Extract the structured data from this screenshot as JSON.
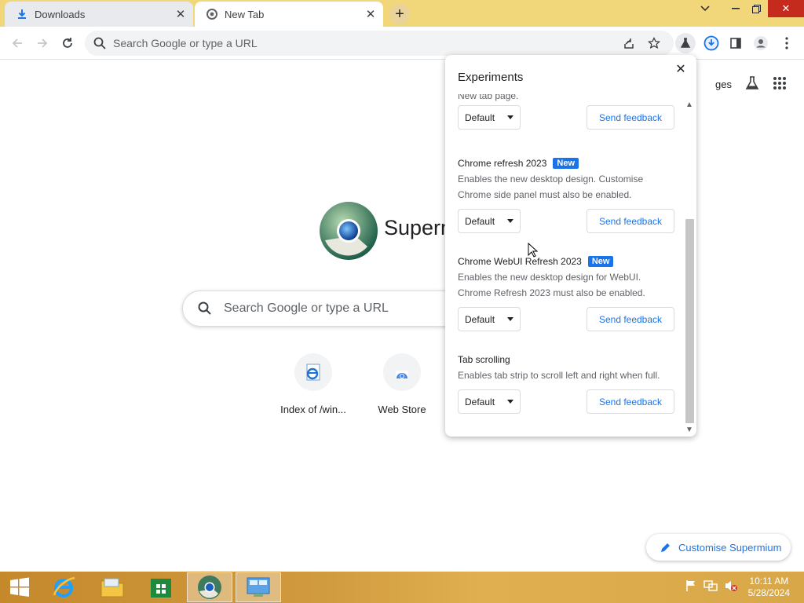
{
  "tabs": [
    {
      "title": "Downloads",
      "icon": "download-icon"
    },
    {
      "title": "New Tab",
      "icon": "chrome-icon"
    }
  ],
  "toolbar": {
    "omnibox_placeholder": "Search Google or type a URL"
  },
  "ntp": {
    "logo_text": "Superm",
    "header_link": "ges",
    "search_placeholder": "Search Google or type a URL",
    "shortcuts": [
      {
        "label": "Index of /win...",
        "icon": "ie-page-icon"
      },
      {
        "label": "Web Store",
        "icon": "web-store-icon"
      }
    ],
    "customise_label": "Customise Supermium"
  },
  "experiments": {
    "title": "Experiments",
    "items": [
      {
        "name": "",
        "badge": "",
        "desc": [
          "New tab page."
        ],
        "select": "Default",
        "feedback": "Send feedback"
      },
      {
        "name": "Chrome refresh 2023",
        "badge": "New",
        "desc": [
          "Enables the new desktop design. Customise",
          "Chrome side panel must also be enabled."
        ],
        "select": "Default",
        "feedback": "Send feedback"
      },
      {
        "name": "Chrome WebUI Refresh 2023",
        "badge": "New",
        "desc": [
          "Enables the new desktop design for WebUI.",
          "Chrome Refresh 2023 must also be enabled."
        ],
        "select": "Default",
        "feedback": "Send feedback"
      },
      {
        "name": "Tab scrolling",
        "badge": "",
        "desc": [
          "Enables tab strip to scroll left and right when full."
        ],
        "select": "Default",
        "feedback": "Send feedback"
      }
    ]
  },
  "taskbar": {
    "time": "10:11 AM",
    "date": "5/28/2024"
  },
  "colors": {
    "accent": "#1a73e8",
    "tabstrip": "#f1d77a",
    "close_red": "#c42b1c"
  }
}
